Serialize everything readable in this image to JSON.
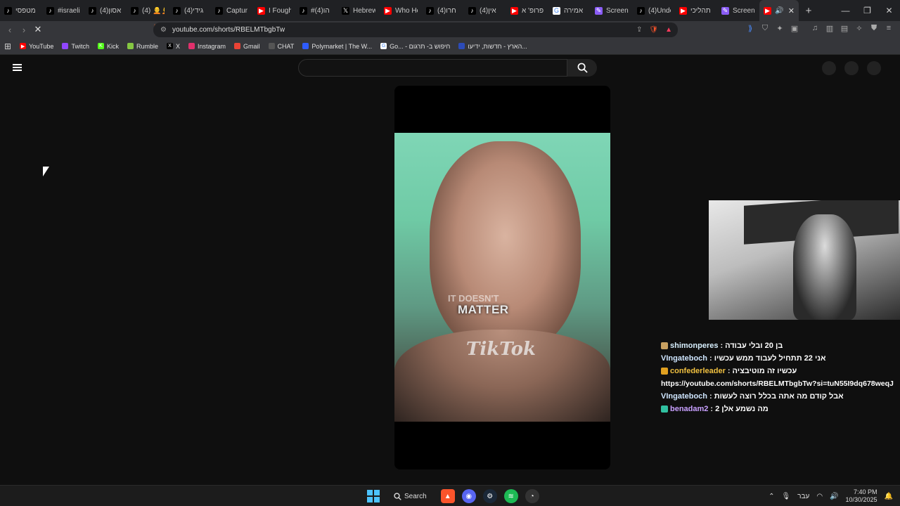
{
  "browser": {
    "tabs": [
      {
        "label": "מטפסי",
        "icon": "tiktok-icon",
        "color": "#000000"
      },
      {
        "label": "#israeli",
        "icon": "tiktok-icon",
        "color": "#000000"
      },
      {
        "label": "(4)אסון",
        "icon": "tiktok-icon",
        "color": "#000000"
      },
      {
        "label": "(4) 🧑‍🦲🧑‍🦲",
        "icon": "tiktok-icon",
        "color": "#000000"
      },
      {
        "label": "(4)גידי",
        "icon": "tiktok-icon",
        "color": "#000000"
      },
      {
        "label": "Captur",
        "icon": "tiktok-icon",
        "color": "#000000"
      },
      {
        "label": "I Fough",
        "icon": "youtube-icon",
        "color": "#ff0000"
      },
      {
        "label": "#הו(4)",
        "icon": "tiktok-icon",
        "color": "#000000"
      },
      {
        "label": "Hebrew",
        "icon": "x-icon",
        "color": "#000000"
      },
      {
        "label": "Who He",
        "icon": "youtube-icon",
        "color": "#ff0000"
      },
      {
        "label": "(4)חרו",
        "icon": "tiktok-icon",
        "color": "#000000"
      },
      {
        "label": "(4)אין",
        "icon": "tiktok-icon",
        "color": "#000000"
      },
      {
        "label": "פרופ' א",
        "icon": "youtube-icon",
        "color": "#ff0000"
      },
      {
        "label": "אמירה",
        "icon": "google-icon",
        "color": "#ffffff"
      },
      {
        "label": "Screen",
        "icon": "pen-icon",
        "color": "#8a5cf6"
      },
      {
        "label": "(4)Unde",
        "icon": "tiktok-icon",
        "color": "#000000"
      },
      {
        "label": "תהליכי",
        "icon": "youtube-icon",
        "color": "#ff0000"
      },
      {
        "label": "Screen",
        "icon": "pen-icon",
        "color": "#8a5cf6"
      }
    ],
    "active_tab": {
      "label": "",
      "icon": "youtube-icon"
    },
    "new_tab_label": "+",
    "url": "youtube.com/shorts/RBELMTbgbTw"
  },
  "bookmarks": [
    {
      "label": "YouTube",
      "icon": "youtube-icon",
      "color": "#ff0000"
    },
    {
      "label": "Twitch",
      "icon": "twitch-icon",
      "color": "#9146ff"
    },
    {
      "label": "Kick",
      "icon": "kick-icon",
      "color": "#53fc18"
    },
    {
      "label": "Rumble",
      "icon": "rumble-icon",
      "color": "#85c742"
    },
    {
      "label": "X",
      "icon": "x-icon",
      "color": "#000000"
    },
    {
      "label": "Instagram",
      "icon": "instagram-icon",
      "color": "#e1306c"
    },
    {
      "label": "Gmail",
      "icon": "gmail-icon",
      "color": "#ea4335"
    },
    {
      "label": "CHAT",
      "icon": "chatgpt-icon",
      "color": "#555555"
    },
    {
      "label": "Polymarket | The W...",
      "icon": "polymarket-icon",
      "color": "#2e5cff"
    },
    {
      "label": "Go... - חיפוש ב- תרגום",
      "icon": "google-icon",
      "color": "#ffffff"
    },
    {
      "label": "הארץ - חדשות, ידיעו...",
      "icon": "haaretz-icon",
      "color": "#2c4bb8"
    }
  ],
  "video": {
    "caption_top": "IT DOESN'T",
    "caption_main": "MATTER",
    "watermark": "TikTok"
  },
  "chat": [
    {
      "user": "shimonperes",
      "text": "בן 20 ובלי עבודה",
      "user_color": "#d8f0ff",
      "emote_color": "#c8a060"
    },
    {
      "user": "VIngateboch",
      "text": "אני 22 תתחיל לעבוד ממש עכשיו",
      "user_color": "#cfe6ff",
      "emote_color": null
    },
    {
      "user": "confederleader",
      "text": "עכשיו זה מוטיבציה",
      "user_color": "#f0c040",
      "emote_color": "#e0a020"
    },
    {
      "user": "",
      "text": "https://youtube.com/shorts/RBELMTbgbTw?si=tuN55I9dq678weqJ",
      "user_color": "#ffffff",
      "emote_color": null
    },
    {
      "user": "VIngateboch",
      "text": "אבל קודם מה אתה בכלל רוצה לעשות",
      "user_color": "#cfe6ff",
      "emote_color": null
    },
    {
      "user": "benadam2",
      "text": "מה נשמע אלן 2",
      "user_color": "#c8a0ff",
      "emote_color": "#30c0a0"
    }
  ],
  "taskbar": {
    "search_label": "Search",
    "language": "עבר",
    "time": "7:40 PM",
    "date": "10/30/2025"
  }
}
